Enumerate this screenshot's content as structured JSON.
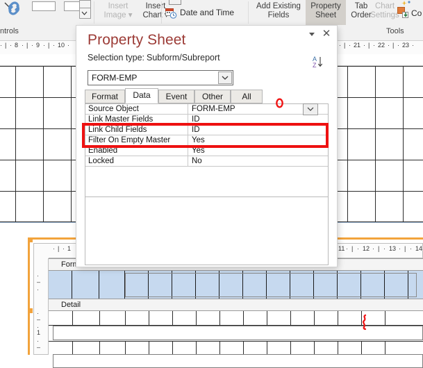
{
  "app": {
    "name": "Microsoft Access Form Designer"
  },
  "ribbon": {
    "group_labels": {
      "controls": "ntrols",
      "tools": "Tools"
    },
    "buttons": [
      {
        "name": "insert-image",
        "line1": "Insert",
        "line2": "Image ▾",
        "disabled": true
      },
      {
        "name": "insert-chart",
        "line1": "Insert",
        "line2": "Chart ▾",
        "disabled": false
      },
      {
        "name": "date-and-time",
        "line1": "Date and Time",
        "line2": "",
        "disabled": false
      },
      {
        "name": "add-existing-fields",
        "line1": "Add Existing",
        "line2": "Fields",
        "disabled": false
      },
      {
        "name": "property-sheet",
        "line1": "Property",
        "line2": "Sheet",
        "disabled": false,
        "active": true
      },
      {
        "name": "tab-order",
        "line1": "Tab",
        "line2": "Order",
        "disabled": false
      },
      {
        "name": "chart-settings",
        "line1": "Chart",
        "line2": "Settings",
        "disabled": true
      },
      {
        "name": "convert-macros",
        "line1": "Co",
        "line2": "",
        "disabled": false
      }
    ]
  },
  "property_sheet": {
    "title": "Property Sheet",
    "selection_type_label": "Selection type:",
    "selection_type_value": "Subform/Subreport",
    "combo_value": "FORM-EMP",
    "sort_icon": "sort-az-icon",
    "collapse_icon": "chevron-down-icon",
    "close_icon": "✕",
    "tabs": [
      {
        "label": "Format",
        "active": false
      },
      {
        "label": "Data",
        "active": true
      },
      {
        "label": "Event",
        "active": false
      },
      {
        "label": "Other",
        "active": false
      },
      {
        "label": "All",
        "active": false
      }
    ],
    "properties": [
      {
        "name": "Source Object",
        "value": "FORM-EMP",
        "has_dropdown": true,
        "highlighted": false
      },
      {
        "name": "Link Master Fields",
        "value": "ID",
        "has_dropdown": false,
        "highlighted": true
      },
      {
        "name": "Link Child Fields",
        "value": "ID",
        "has_dropdown": false,
        "highlighted": true
      },
      {
        "name": "Filter On Empty Master",
        "value": "Yes",
        "has_dropdown": false,
        "highlighted": false
      },
      {
        "name": "Enabled",
        "value": "Yes",
        "has_dropdown": false,
        "highlighted": false
      },
      {
        "name": "Locked",
        "value": "No",
        "has_dropdown": false,
        "highlighted": false
      }
    ]
  },
  "annotations": {
    "highlight_color": "#ee1111",
    "rectangle_target": "Link Master Fields / Link Child Fields rows",
    "marks": [
      {
        "name": "red-circle-mark",
        "shape": "circle"
      },
      {
        "name": "red-squiggle-mark",
        "shape": "squiggle"
      }
    ]
  },
  "background_form": {
    "ruler_ticks": [
      "8",
      "9",
      "10",
      "21",
      "22",
      "23"
    ]
  },
  "inner_form": {
    "ruler_ticks": [
      "1",
      "11",
      "12",
      "13",
      "14"
    ],
    "vertical_ruler_ticks": [
      "1"
    ],
    "sections": [
      {
        "label": "Form Header",
        "name": "section-form-header"
      },
      {
        "label": "Detail",
        "name": "section-detail"
      }
    ],
    "header_band_color": "#c6d9ef",
    "selection_border_color": "#f2a33c"
  }
}
